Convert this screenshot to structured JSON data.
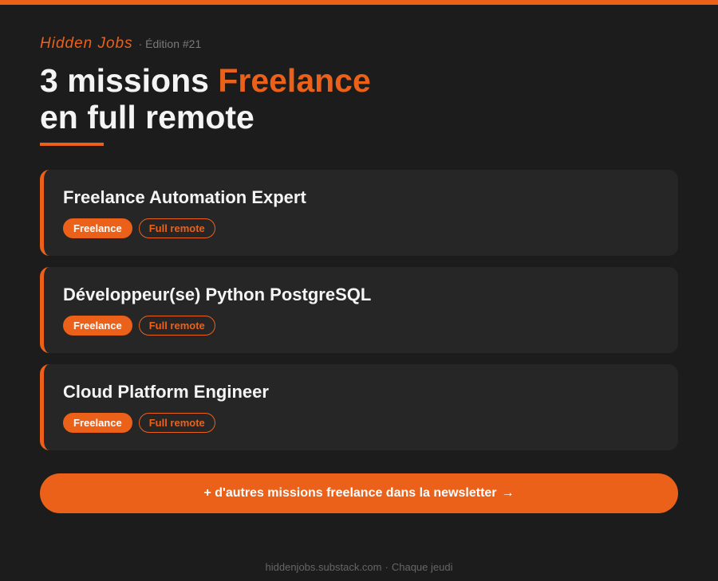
{
  "brand": {
    "name": "Hidden Jobs",
    "edition": "· Édition #21"
  },
  "headline": {
    "part1": "3 missions ",
    "accent": "Freelance",
    "line2": "en full remote"
  },
  "missions": [
    {
      "title": "Freelance Automation Expert",
      "tags": [
        "Freelance",
        "Full remote"
      ]
    },
    {
      "title": "Développeur(se) Python PostgreSQL",
      "tags": [
        "Freelance",
        "Full remote"
      ]
    },
    {
      "title": "Cloud Platform Engineer",
      "tags": [
        "Freelance",
        "Full remote"
      ]
    }
  ],
  "cta": {
    "label": "+ d'autres missions freelance dans la newsletter",
    "arrow": "→"
  },
  "footer": {
    "site": "hiddenjobs.substack.com",
    "separator": "·",
    "schedule": "Chaque jeudi"
  },
  "colors": {
    "accent": "#ec611a",
    "background": "#1c1c1c",
    "card": "#262626"
  }
}
